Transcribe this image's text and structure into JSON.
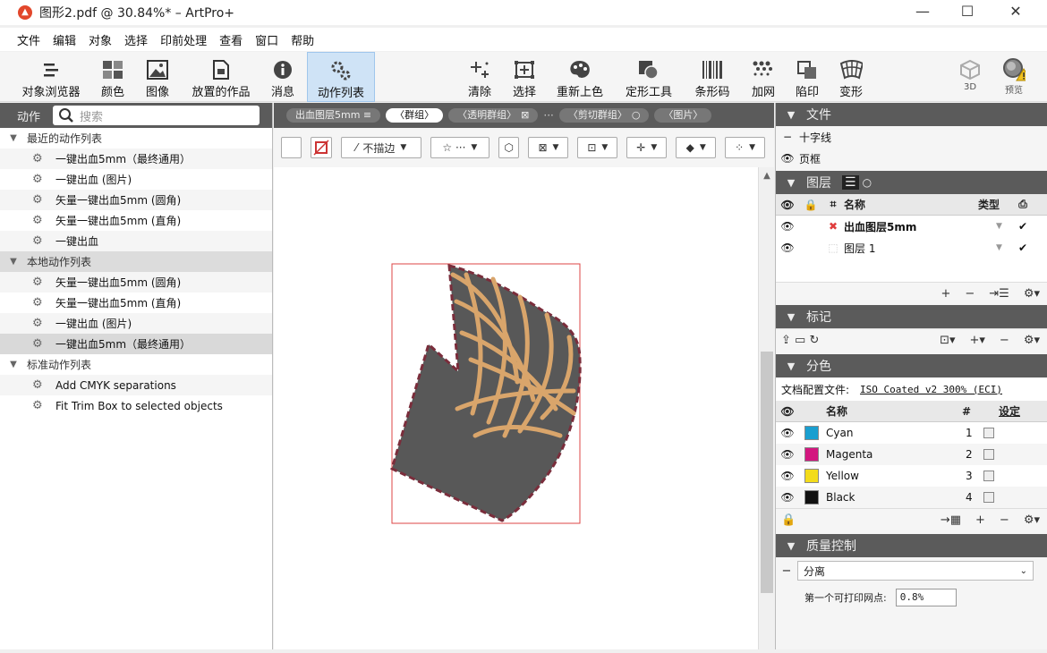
{
  "window": {
    "app_icon": "artpro-logo-icon",
    "title": "图形2.pdf @ 30.84%* – ArtPro+"
  },
  "menu": [
    "文件",
    "编辑",
    "对象",
    "选择",
    "印前处理",
    "查看",
    "窗口",
    "帮助"
  ],
  "toolbar": {
    "tools": [
      {
        "label": "对象浏览器",
        "icon": "object-browser-icon"
      },
      {
        "label": "颜色",
        "icon": "color-grid-icon"
      },
      {
        "label": "图像",
        "icon": "image-icon"
      },
      {
        "label": "放置的作品",
        "icon": "placed-art-icon"
      },
      {
        "label": "消息",
        "icon": "info-icon"
      },
      {
        "label": "动作列表",
        "icon": "action-list-icon",
        "active": true
      },
      {
        "label": "清除",
        "icon": "clear-sparkle-icon"
      },
      {
        "label": "选择",
        "icon": "select-icon"
      },
      {
        "label": "重新上色",
        "icon": "recolor-palette-icon"
      },
      {
        "label": "定形工具",
        "icon": "shape-tool-icon"
      },
      {
        "label": "条形码",
        "icon": "barcode-icon"
      },
      {
        "label": "加网",
        "icon": "screening-icon"
      },
      {
        "label": "陷印",
        "icon": "trapping-icon"
      },
      {
        "label": "变形",
        "icon": "distort-icon"
      },
      {
        "label": "3D",
        "icon": "cube-3d-icon"
      },
      {
        "label": "预览",
        "icon": "preview-warning-icon"
      }
    ]
  },
  "left_panel": {
    "title": "动作",
    "search_placeholder": "搜索",
    "groups": [
      {
        "label": "最近的动作列表",
        "items": [
          "一键出血5mm（最终通用）",
          "一键出血 (图片)",
          "矢量一键出血5mm (圆角)",
          "矢量一键出血5mm (直角)",
          "一键出血"
        ]
      },
      {
        "label": "本地动作列表",
        "selected": true,
        "items": [
          "矢量一键出血5mm (圆角)",
          "矢量一键出血5mm (直角)",
          "一键出血 (图片)",
          "一键出血5mm（最终通用）"
        ]
      },
      {
        "label": "标准动作列表",
        "items": [
          "Add CMYK separations",
          "Fit Trim Box to selected objects"
        ]
      }
    ]
  },
  "breadcrumb": {
    "items": [
      "出血图层5mm ≡",
      "〈群组〉",
      "〈透明群组〉",
      "〈剪切群组〉",
      "〈图片〉"
    ],
    "active_index": 1,
    "ellipsis": "···"
  },
  "attr_bar": {
    "stroke_label": "不描边"
  },
  "right_panel": {
    "file_section": {
      "title": "文件",
      "rows": [
        {
          "toggle": "−",
          "label": "十字线"
        },
        {
          "toggle": "👁",
          "label": "页框"
        }
      ]
    },
    "layers": {
      "title": "图层",
      "col_name": "名称",
      "col_type": "类型",
      "rows": [
        {
          "name": "出血图层5mm",
          "color": "#e03c3c",
          "bold": true
        },
        {
          "name": "图层 1",
          "color": "#cccccc",
          "bold": false
        }
      ]
    },
    "marks": {
      "title": "标记"
    },
    "separations": {
      "title": "分色",
      "profile_label": "文档配置文件:",
      "profile_value": "ISO Coated v2 300% (ECI)",
      "col_name": "名称",
      "col_num": "#",
      "col_setting": "设定",
      "inks": [
        {
          "name": "Cyan",
          "num": "1",
          "color": "#1a9fd0"
        },
        {
          "name": "Magenta",
          "num": "2",
          "color": "#d3177f"
        },
        {
          "name": "Yellow",
          "num": "3",
          "color": "#f3dc1b"
        },
        {
          "name": "Black",
          "num": "4",
          "color": "#111111"
        }
      ]
    },
    "qc": {
      "title": "质量控制",
      "dropdown": "分离",
      "field_label": "第一个可打印网点:",
      "field_value": "0.8%"
    }
  }
}
